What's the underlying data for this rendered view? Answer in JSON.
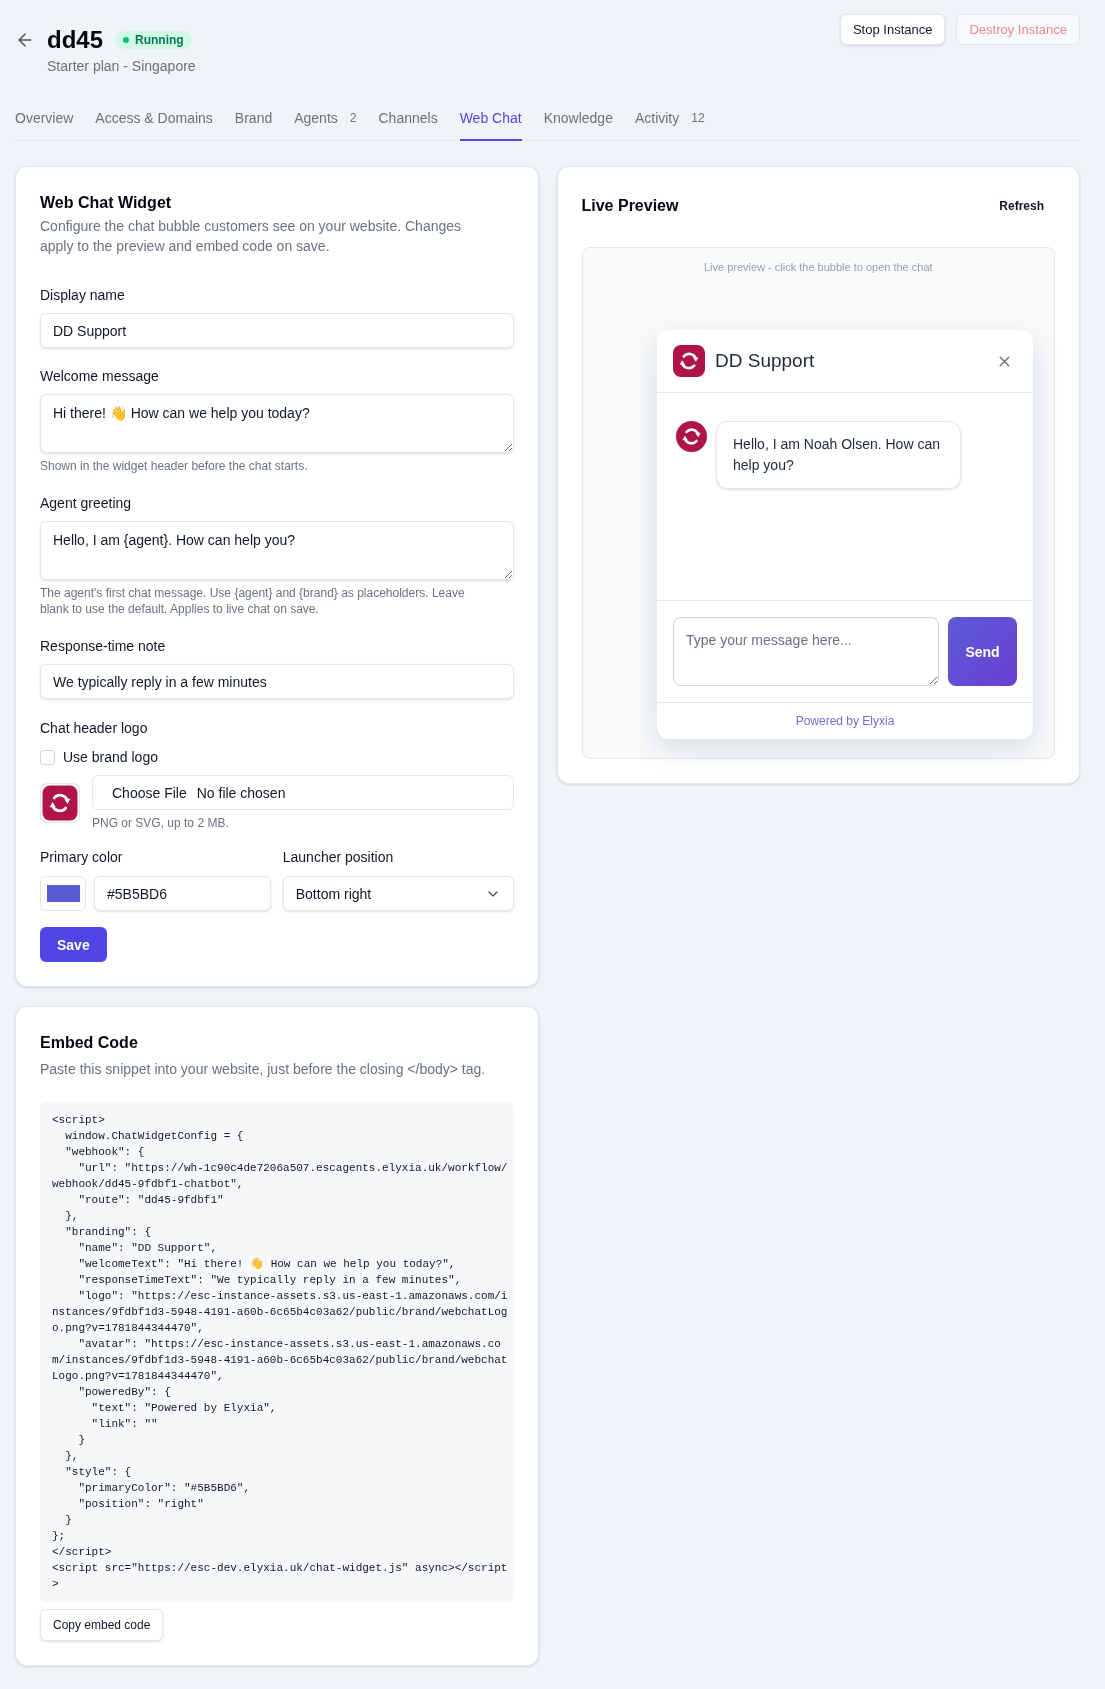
{
  "header": {
    "title": "dd45",
    "status": {
      "label": "Running",
      "kind": "running"
    },
    "subtitle": "Starter plan - Singapore",
    "actions": [
      {
        "label": "Stop Instance",
        "kind": "default",
        "disabled": false
      },
      {
        "label": "Destroy Instance",
        "kind": "danger",
        "disabled": true
      }
    ]
  },
  "tabs": [
    {
      "label": "Overview",
      "selected": false
    },
    {
      "label": "Access & Domains",
      "selected": false
    },
    {
      "label": "Brand",
      "selected": false
    },
    {
      "label": "Agents",
      "count": "2",
      "selected": false
    },
    {
      "label": "Channels",
      "selected": false
    },
    {
      "label": "Web Chat",
      "selected": true
    },
    {
      "label": "Knowledge",
      "selected": false
    },
    {
      "label": "Activity",
      "count": "12",
      "selected": false
    }
  ],
  "widget_form": {
    "title": "Web Chat Widget",
    "description": "Configure the chat bubble customers see on your website. Changes apply to the preview and embed code on save.",
    "display_name": {
      "label": "Display name",
      "value": "DD Support"
    },
    "welcome_message": {
      "label": "Welcome message",
      "value": "Hi there! 👋 How can we help you today?",
      "help": "Shown in the widget header before the chat starts."
    },
    "agent_greeting": {
      "label": "Agent greeting",
      "value": "Hello, I am {agent}. How can help you?",
      "help": "The agent's first chat message. Use {agent} and {brand} as placeholders. Leave blank to use the default. Applies to live chat on save."
    },
    "response_time_note": {
      "label": "Response-time note",
      "value": "We typically reply in a few minutes"
    },
    "chat_header_logo": {
      "label": "Chat header logo",
      "use_brand_logo": {
        "label": "Use brand logo",
        "checked": false
      },
      "file_button": "Choose File",
      "file_status": "No file chosen",
      "help": "PNG or SVG, up to 2 MB."
    },
    "primary_color": {
      "label": "Primary color",
      "value": "#5B5BD6"
    },
    "launcher_position": {
      "label": "Launcher position",
      "value": "Bottom right"
    },
    "save_button": "Save"
  },
  "live_preview": {
    "title": "Live Preview",
    "refresh_button": "Refresh",
    "caption": "Live preview - click the bubble to open the chat",
    "chat": {
      "title": "DD Support",
      "messages": [
        {
          "kind": "agent",
          "text": "Hello, I am Noah Olsen. How can help you?"
        }
      ],
      "input": {
        "placeholder": "Type your message here..."
      },
      "send_button": "Send",
      "powered_by": "Powered by Elyxia"
    }
  },
  "embed_code": {
    "title": "Embed Code",
    "description": "Paste this snippet into your website, just before the closing </body> tag.",
    "code": "<script>\n  window.ChatWidgetConfig = {\n  \"webhook\": {\n    \"url\": \"https://wh-1c90c4de7206a507.escagents.elyxia.uk/workflow/\nwebhook/dd45-9fdbf1-chatbot\",\n    \"route\": \"dd45-9fdbf1\"\n  },\n  \"branding\": {\n    \"name\": \"DD Support\",\n    \"welcomeText\": \"Hi there! 👋 How can we help you today?\",\n    \"responseTimeText\": \"We typically reply in a few minutes\",\n    \"logo\": \"https://esc-instance-assets.s3.us-east-1.amazonaws.com/i\nnstances/9fdbf1d3-5948-4191-a60b-6c65b4c03a62/public/brand/webchatLog\no.png?v=1781844344470\",\n    \"avatar\": \"https://esc-instance-assets.s3.us-east-1.amazonaws.co\nm/instances/9fdbf1d3-5948-4191-a60b-6c65b4c03a62/public/brand/webchat\nLogo.png?v=1781844344470\",\n    \"poweredBy\": {\n      \"text\": \"Powered by Elyxia\",\n      \"link\": \"\"\n    }\n  },\n  \"style\": {\n    \"primaryColor\": \"#5B5BD6\",\n    \"position\": \"right\"\n  }\n};\n</script>\n<script src=\"https://esc-dev.elyxia.uk/chat-widget.js\" async></script\n>",
    "copy_button": "Copy embed code"
  }
}
